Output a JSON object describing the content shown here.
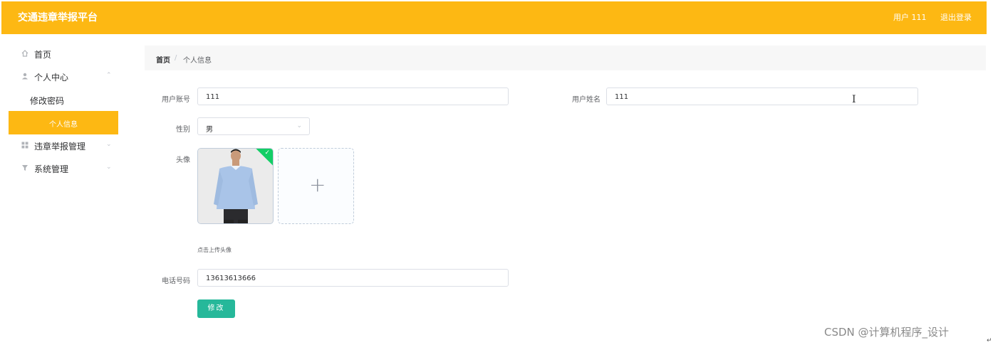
{
  "header": {
    "title": "交通违章举报平台",
    "user": "用户 111",
    "logout": "退出登录",
    "bg_color": "#fdb813"
  },
  "sidebar": {
    "items": [
      {
        "label": "首页",
        "icon": "home-icon"
      },
      {
        "label": "个人中心",
        "icon": "user-icon",
        "expanded": true
      },
      {
        "label": "违章举报管理",
        "icon": "grid-icon"
      },
      {
        "label": "系统管理",
        "icon": "filter-icon"
      }
    ],
    "sub_items": [
      {
        "label": "修改密码"
      },
      {
        "label": "个人信息",
        "active": true
      }
    ]
  },
  "breadcrumb": {
    "home": "首页",
    "separator": "/",
    "current": "个人信息"
  },
  "form": {
    "account_label": "用户账号",
    "account_value": "111",
    "name_label": "用户姓名",
    "name_value": "111",
    "gender_label": "性别",
    "gender_value": "男",
    "avatar_label": "头像",
    "upload_tip": "点击上传头像",
    "phone_label": "电话号码",
    "phone_value": "13613613666",
    "submit_label": "修改"
  },
  "watermark": "CSDN @计算机程序_设计",
  "accent_colors": {
    "primary": "#fdb813",
    "button": "#26b89a",
    "success": "#13ce66"
  }
}
